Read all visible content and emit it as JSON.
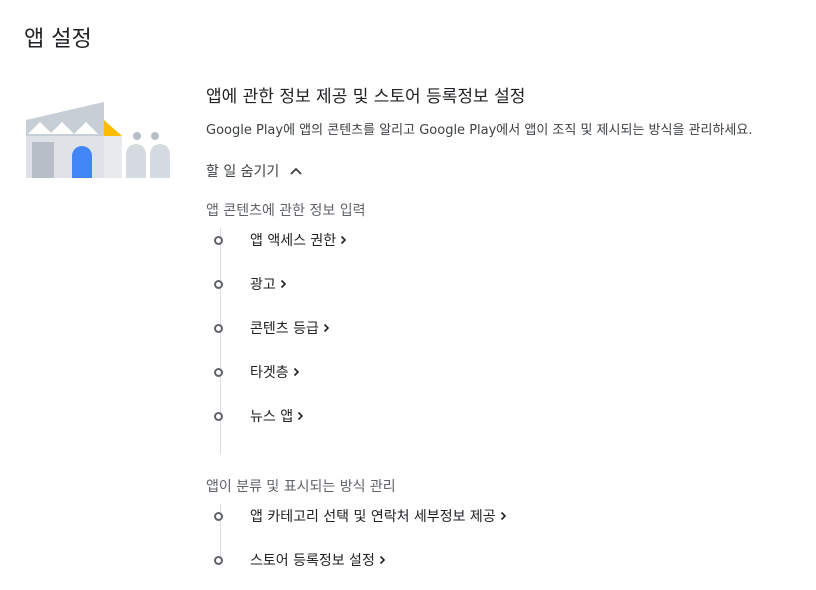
{
  "page": {
    "title": "앱 설정"
  },
  "section": {
    "title": "앱에 관한 정보 제공 및 스토어 등록정보 설정",
    "description": "Google Play에 앱의 콘텐츠를 알리고 Google Play에서 앱이 조직 및 제시되는 방식을 관리하세요."
  },
  "toggle": {
    "label": "할 일 숨기기",
    "icon": "chevron-up-icon"
  },
  "groups": [
    {
      "title": "앱 콘텐츠에 관한 정보 입력",
      "tasks": [
        {
          "label": "앱 액세스 권한"
        },
        {
          "label": "광고"
        },
        {
          "label": "콘텐츠 등급"
        },
        {
          "label": "타겟층"
        },
        {
          "label": "뉴스 앱"
        }
      ]
    },
    {
      "title": "앱이 분류 및 표시되는 방식 관리",
      "tasks": [
        {
          "label": "앱 카테고리 선택 및 연락처 세부정보 제공"
        },
        {
          "label": "스토어 등록정보 설정"
        }
      ]
    }
  ],
  "colors": {
    "text": "#202124",
    "muted": "#5f6368",
    "timeline": "#dadce0",
    "accent_blue": "#4285f4",
    "accent_yellow": "#fbbc04"
  }
}
